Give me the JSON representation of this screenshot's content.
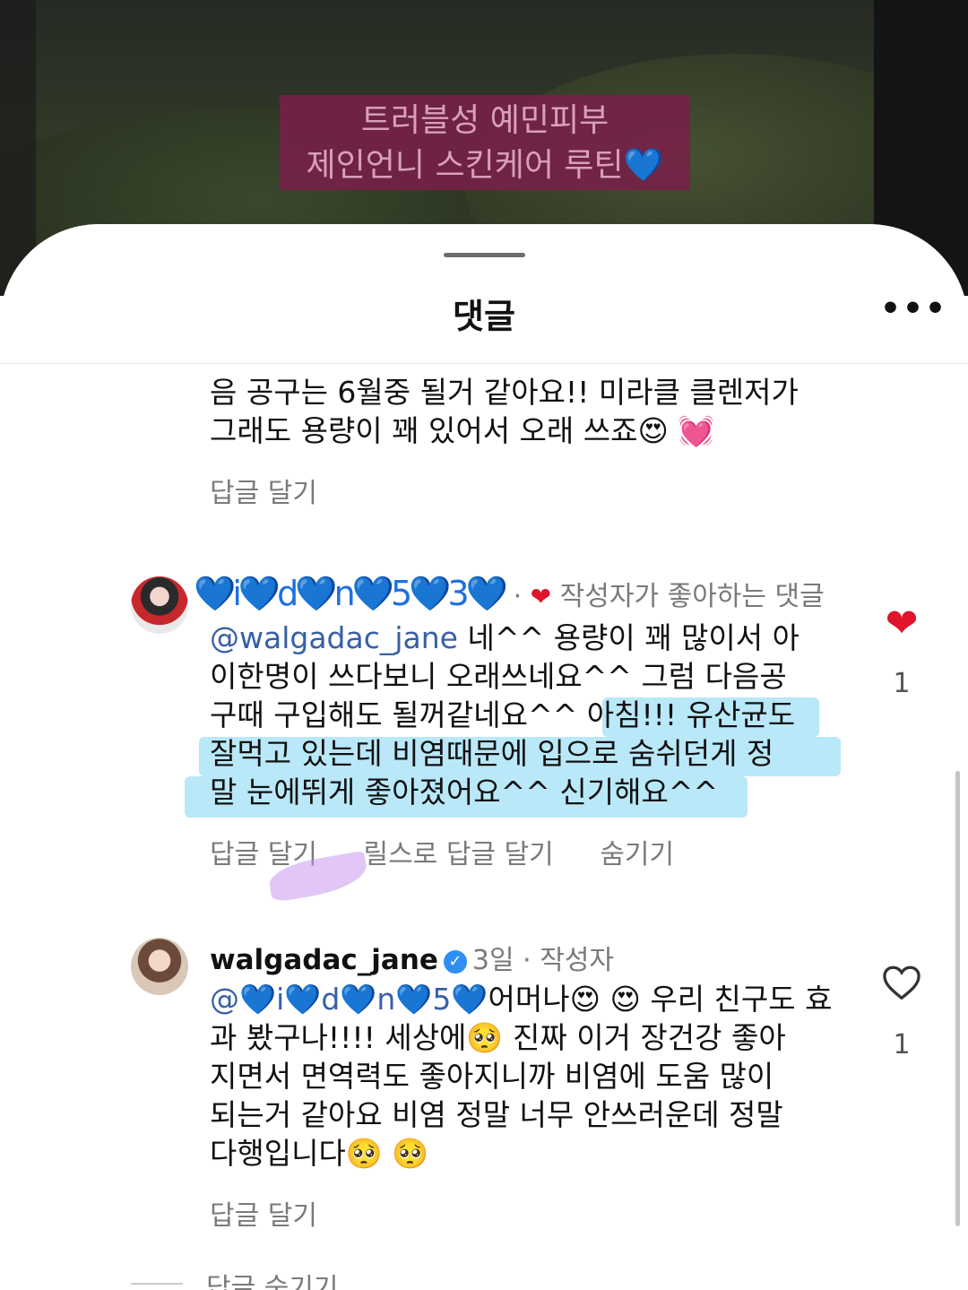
{
  "video": {
    "caption_line1": "트러블성 예민피부",
    "caption_line2": "제인언니 스킨케어 루틴",
    "caption_heart": "💙"
  },
  "sheet": {
    "title": "댓글",
    "more_icon": "more-horizontal-icon"
  },
  "comments": [
    {
      "text_partial_line1": "음 공구는 6월중 될거 같아요!! 미라클 클렌저가",
      "text_partial_line2": "그래도 용량이 꽤 있어서 오래 쓰죠😍 💓",
      "reply_label": "답글 달기"
    },
    {
      "username": "💙i💙d💙n💙5💙3💙",
      "separator": "·",
      "creator_liked_label": "작성자가 좋아하는 댓글",
      "mention": "@walgadac_jane",
      "text_line1": "네^^ 용량이 꽤 많이서 아",
      "text_line2": "이한명이 쓰다보니 오래쓰네요^^ 그럼 다음공",
      "text_line3": "구때 구입해도 될꺼같네요^^ 아침!!! 유산균도",
      "text_line4": "잘먹고 있는데 비염때문에 입으로 숨쉬던게 정",
      "text_line5": "말 눈에뛰게 좋아졌어요^^ 신기해요^^",
      "reply_label": "답글 달기",
      "reels_reply_label": "릴스로 답글 달기",
      "hide_label": "숨기기",
      "like_count": "1",
      "liked": true
    },
    {
      "username": "walgadac_jane",
      "time": "3일",
      "author_label": "· 작성자",
      "mention": "@💙i💙d💙n💙5💙",
      "text_line1": "어머나😍 😍 우리 친구도 효",
      "text_line2": "과 봤구나!!!! 세상에🥺 진짜 이거 장건강 좋아",
      "text_line3": "지면서 면역력도 좋아지니까 비염에 도움 많이",
      "text_line4": "되는거 같아요 비염 정말 너무 안쓰러운데 정말",
      "text_line5": "다행입니다🥺 🥺",
      "reply_label": "답글 달기",
      "like_count": "1",
      "liked": false
    }
  ],
  "hide_replies_label": "답글 숨기기",
  "colors": {
    "like_red": "#e0142b",
    "mention_blue": "#3760a6",
    "verified_blue": "#2d8ef6",
    "highlight_cyan": "#7fd6f2"
  }
}
